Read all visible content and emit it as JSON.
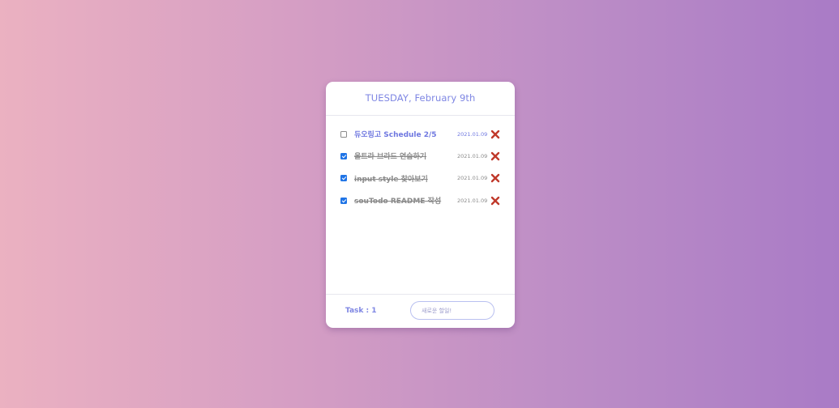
{
  "header": {
    "date_label": "TUESDAY, February 9th"
  },
  "todos": [
    {
      "text": "듀오링고 Schedule 2/5",
      "date": "2021.01.09",
      "done": false
    },
    {
      "text": "울트라 브라드 연습하기",
      "date": "2021.01.09",
      "done": true
    },
    {
      "text": "input style 찾아보기",
      "date": "2021.01.09",
      "done": true
    },
    {
      "text": "souTodo README 작성",
      "date": "2021.01.09",
      "done": true
    }
  ],
  "footer": {
    "task_count": "Task : 1",
    "new_task_placeholder": "새로운 할일!"
  },
  "icons": {
    "delete": "close-icon"
  },
  "colors": {
    "accent": "#7e86e3",
    "delete": "#c0392b",
    "checkbox": "#1f74e6"
  }
}
